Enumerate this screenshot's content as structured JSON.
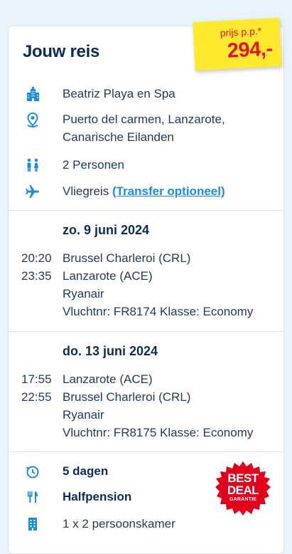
{
  "header": {
    "title": "Jouw reis"
  },
  "price": {
    "label": "prijs p.p.*",
    "amount": "294,-"
  },
  "info": {
    "hotel": "Beatriz Playa en Spa",
    "location_line1": "Puerto del carmen, Lanzarote,",
    "location_line2": "Canarische Eilanden",
    "persons": "2 Personen",
    "travel_type": "Vliegreis",
    "transfer_link": "(Transfer optioneel)"
  },
  "outbound": {
    "date": "zo. 9 juni 2024",
    "depart_time": "20:20",
    "arrive_time": "23:35",
    "from": "Brussel Charleroi (CRL)",
    "to": "Lanzarote (ACE)",
    "airline": "Ryanair",
    "flight_info": "Vluchtnr: FR8174 Klasse: Economy"
  },
  "return": {
    "date": "do. 13 juni 2024",
    "depart_time": "17:55",
    "arrive_time": "22:55",
    "from": "Lanzarote (ACE)",
    "to": "Brussel Charleroi (CRL)",
    "airline": "Ryanair",
    "flight_info": "Vluchtnr: FR8175 Klasse: Economy"
  },
  "summary": {
    "duration": "5 dagen",
    "board": "Halfpension",
    "room": "1 x 2 persoonskamer"
  },
  "badge": {
    "line1": "BEST",
    "line2": "DEAL",
    "line3": "GARANTIE"
  },
  "colors": {
    "accent": "#1b8ce0",
    "price_tag": "#ffe92e",
    "price_text": "#e1151b",
    "badge": "#e2001a"
  }
}
